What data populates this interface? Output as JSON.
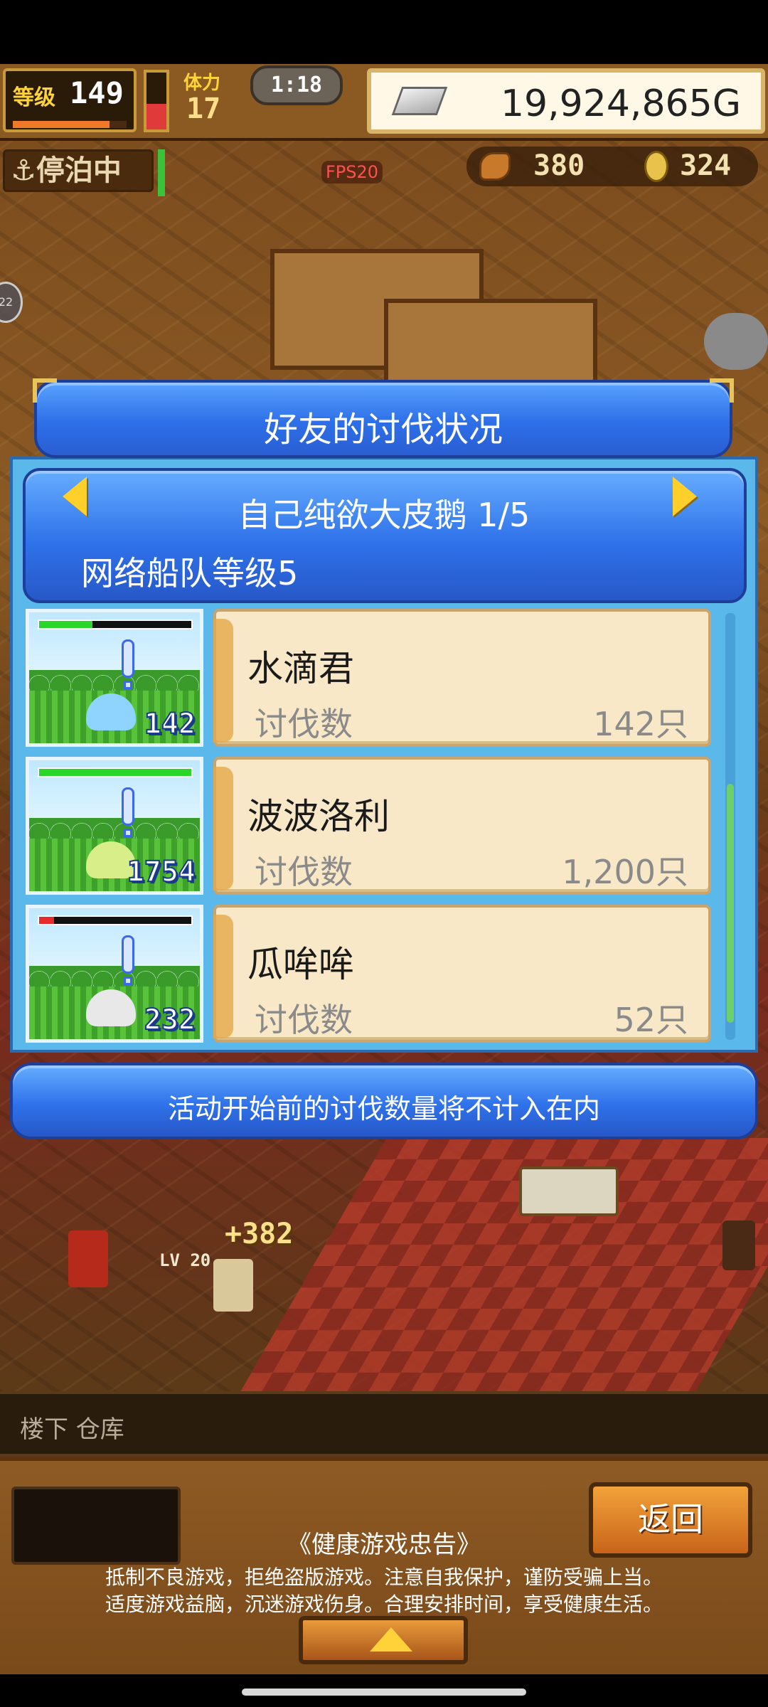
{
  "hud": {
    "level_label": "等级",
    "level_value": "149",
    "level_progress": 0.85,
    "stamina_label": "体力",
    "stamina_value": "17",
    "stamina_fill": 0.45,
    "timer": "1:18",
    "money": "19,924,865G",
    "harbor_status": "停泊中",
    "fps": "FPS20",
    "resource_a": "380",
    "resource_b": "324",
    "side_badge": "22"
  },
  "dialog": {
    "title": "好友的讨伐状况",
    "friend_name": "自己纯欲大皮鹅 1/5",
    "fleet_level": "网络船队等级5",
    "rows": [
      {
        "name": "水滴君",
        "label": "讨伐数",
        "value": "142只",
        "pixel_count": "142",
        "hp": 0.35,
        "hp_color": "#2bd62b",
        "sprite_color": "#8fd4ff"
      },
      {
        "name": "波波洛利",
        "label": "讨伐数",
        "value": "1,200只",
        "pixel_count": "1754",
        "hp": 1.0,
        "hp_color": "#2bd62b",
        "sprite_color": "#d8ee88"
      },
      {
        "name": "瓜哞哞",
        "label": "讨伐数",
        "value": "52只",
        "pixel_count": "232",
        "hp": 0.1,
        "hp_color": "#e82a2a",
        "sprite_color": "#e8e8e8"
      }
    ],
    "notice": "活动开始前的讨伐数量将不计入在内"
  },
  "world": {
    "popup_value": "+382",
    "unit_level": "LV 20"
  },
  "bottom": {
    "floor_text": "楼下 仓库",
    "back_label": "返回",
    "advice_title": "《健康游戏忠告》",
    "advice_line1": "抵制不良游戏，拒绝盗版游戏。注意自我保护，谨防受骗上当。",
    "advice_line2": "适度游戏益脑，沉迷游戏伤身。合理安排时间，享受健康生活。"
  }
}
